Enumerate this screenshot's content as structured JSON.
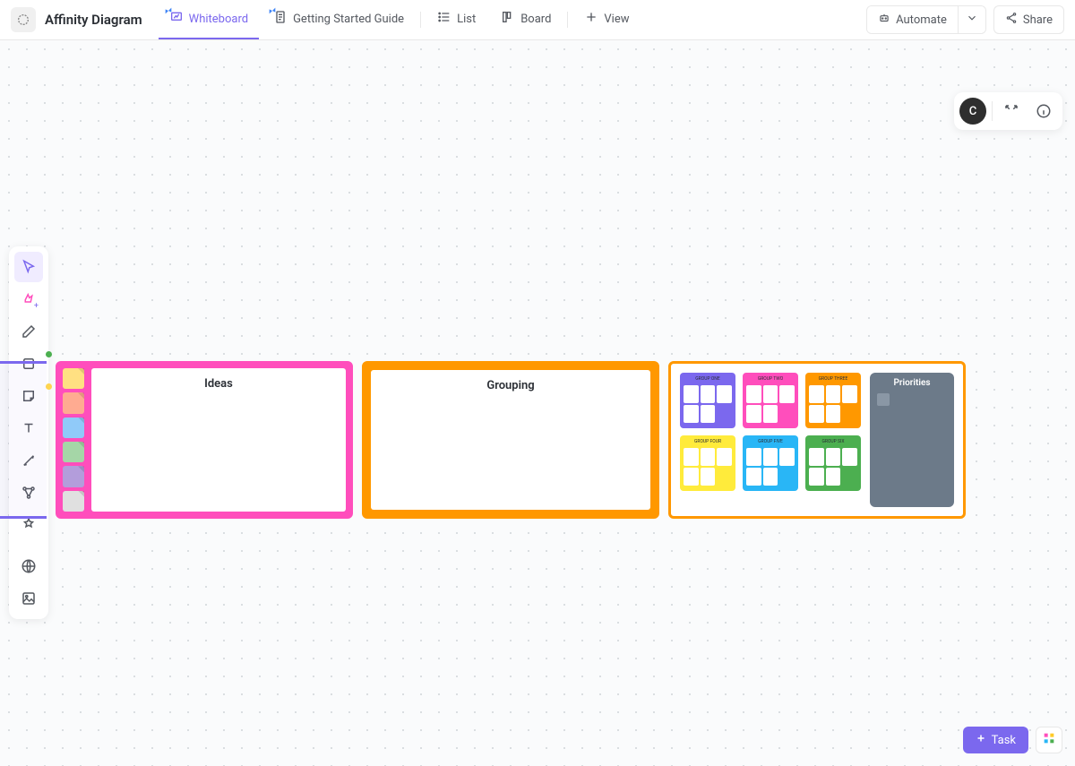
{
  "header": {
    "title": "Affinity Diagram",
    "tabs": {
      "whiteboard": "Whiteboard",
      "guide": "Getting Started Guide",
      "list": "List",
      "board": "Board",
      "addview": "View"
    },
    "automate": "Automate",
    "share": "Share"
  },
  "avatar": {
    "initial": "C"
  },
  "diagram": {
    "ideas_label": "Ideas",
    "grouping_label": "Grouping",
    "priorities_label": "Priorities",
    "note_colors": [
      "#ffe082",
      "#ffab91",
      "#90caf9",
      "#a5d6a7",
      "#b39ddb",
      "#e0e0e0"
    ],
    "cards": [
      {
        "color": "#7b68ee",
        "title": "GROUP ONE"
      },
      {
        "color": "#ff4ebc",
        "title": "GROUP TWO"
      },
      {
        "color": "#ff9800",
        "title": "GROUP THREE"
      },
      {
        "color": "#ffeb3b",
        "title": "GROUP FOUR"
      },
      {
        "color": "#29b6f6",
        "title": "GROUP FIVE"
      },
      {
        "color": "#4caf50",
        "title": "GROUP SIX"
      }
    ]
  },
  "toolbar": {
    "dots": {
      "pen": "#7b68ee",
      "shape": "#4caf50",
      "sticky": "#ffd54f"
    }
  },
  "bottom": {
    "task": "Task"
  }
}
